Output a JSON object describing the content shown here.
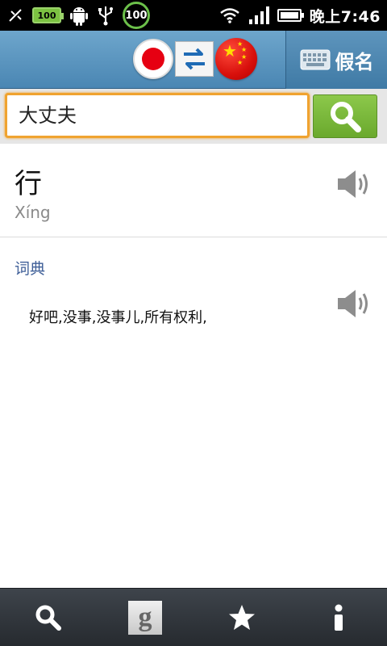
{
  "status_bar": {
    "battery_badge_text": "100",
    "circle_badge_text": "100",
    "time": "晚上7:46"
  },
  "header": {
    "kana_button_label": "假名",
    "source_flag": "japan-flag-icon",
    "target_flag": "china-flag-icon",
    "swap_icon": "swap-arrows-icon"
  },
  "search": {
    "query": "大丈夫",
    "button_icon": "search-icon"
  },
  "result": {
    "headword": "行",
    "pinyin": "Xíng"
  },
  "dictionary": {
    "label": "词典",
    "definition": "好吧,没事,没事儿,所有权利,"
  },
  "bottom_nav": [
    {
      "icon": "search-icon"
    },
    {
      "icon": "google-icon",
      "label": "g"
    },
    {
      "icon": "star-icon"
    },
    {
      "icon": "info-icon"
    }
  ],
  "colors": {
    "header_blue": "#4a86b3",
    "search_orange": "#f0a330",
    "search_green": "#7ab83c",
    "label_blue": "#3f5f98",
    "pinyin_gray": "#8a8a8a",
    "nav_dark": "#2f3338"
  }
}
